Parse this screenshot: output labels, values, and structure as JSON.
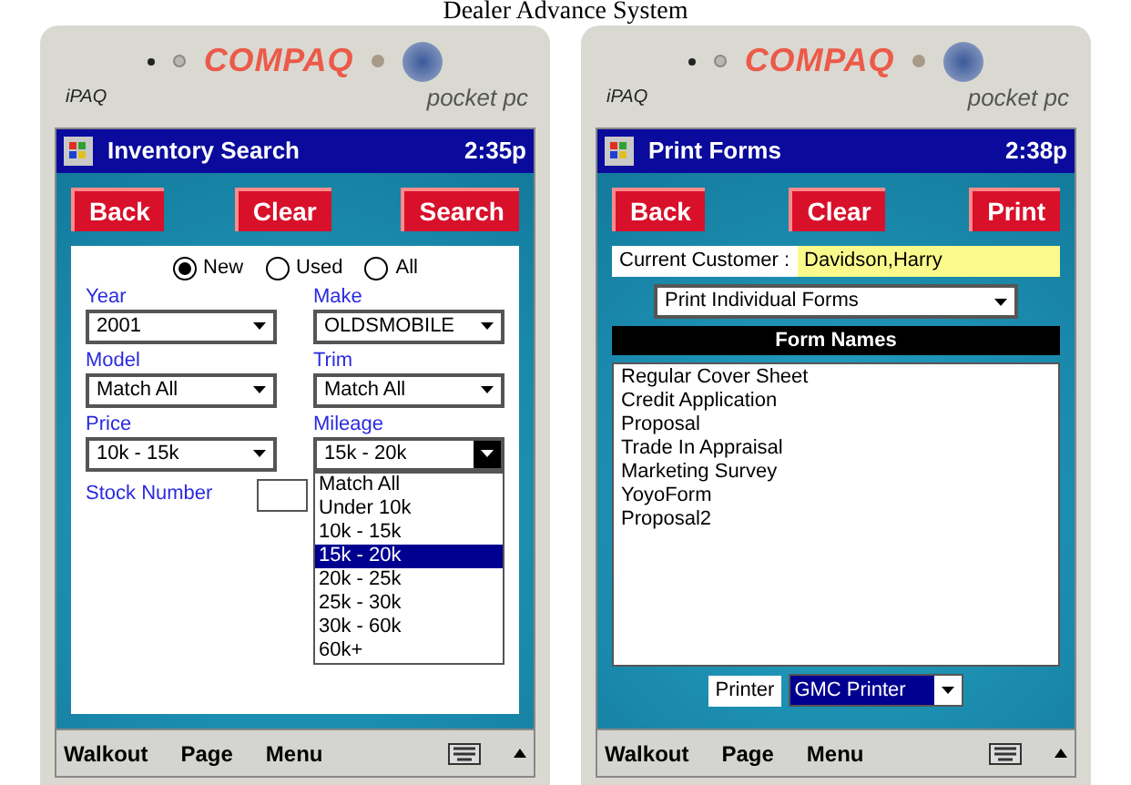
{
  "caption": "Dealer Advance System",
  "devices": [
    {
      "brand": "COMPAQ",
      "model": "iPAQ",
      "platform": "pocket pc",
      "title": "Inventory Search",
      "time": "2:35p",
      "kind": "search",
      "buttons": [
        "Back",
        "Clear",
        "Search"
      ],
      "conditions": [
        {
          "label": "New",
          "selected": true
        },
        {
          "label": "Used",
          "selected": false
        },
        {
          "label": "All",
          "selected": false
        }
      ],
      "fields": [
        {
          "label": "Year",
          "value": "2001",
          "expanded": false
        },
        {
          "label": "Make",
          "value": "OLDSMOBILE",
          "expanded": false
        },
        {
          "label": "Model",
          "value": "Match All",
          "expanded": false
        },
        {
          "label": "Trim",
          "value": "Match All",
          "expanded": false
        },
        {
          "label": "Price",
          "value": "10k - 15k",
          "expanded": false
        },
        {
          "label": "Mileage",
          "value": "15k - 20k",
          "expanded": true
        }
      ],
      "stock_label": "Stock Number",
      "options": [
        {
          "label": "Match All",
          "selected": false
        },
        {
          "label": "Under 10k",
          "selected": false
        },
        {
          "label": "10k - 15k",
          "selected": false
        },
        {
          "label": "15k - 20k",
          "selected": true
        },
        {
          "label": "20k - 25k",
          "selected": false
        },
        {
          "label": "25k - 30k",
          "selected": false
        },
        {
          "label": "30k - 60k",
          "selected": false
        },
        {
          "label": "60k+",
          "selected": false
        }
      ],
      "menu": [
        "Walkout",
        "Page",
        "Menu"
      ]
    },
    {
      "brand": "COMPAQ",
      "model": "iPAQ",
      "platform": "pocket pc",
      "title": "Print Forms",
      "time": "2:38p",
      "kind": "print",
      "buttons": [
        "Back",
        "Clear",
        "Print"
      ],
      "customer_label": "Current Customer :",
      "customer": "Davidson,Harry",
      "form_mode": "Print Individual Forms",
      "list_header": "Form Names",
      "forms": [
        "Regular Cover Sheet",
        "Credit Application",
        "Proposal",
        "Trade In Appraisal",
        "Marketing Survey",
        "YoyoForm",
        "Proposal2"
      ],
      "printer_label": "Printer",
      "printer": "GMC Printer",
      "menu": [
        "Walkout",
        "Page",
        "Menu"
      ]
    }
  ]
}
